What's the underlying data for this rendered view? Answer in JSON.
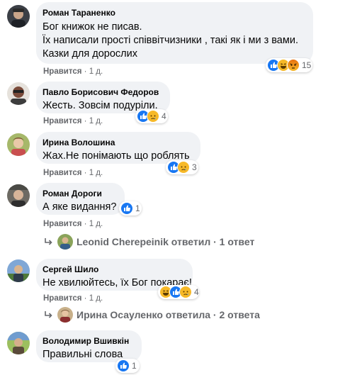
{
  "comments": [
    {
      "author": "Роман Тараненко",
      "lines": [
        "Бог книжок не писав.",
        "Їх написали прості співвітчизники , такі як і ми з вами.",
        "Казки для дорослих"
      ],
      "reactions": [
        "like",
        "haha",
        "angry"
      ],
      "reaction_count": "15",
      "like_label": "Нравится",
      "time": "1 д."
    },
    {
      "author": "Павло Борисович Федоров",
      "lines": [
        "Жесть. Зовсім подуріли."
      ],
      "reactions": [
        "like",
        "sad"
      ],
      "reaction_count": "4",
      "like_label": "Нравится",
      "time": "1 д."
    },
    {
      "author": "Ирина Волошина",
      "lines": [
        "Жах.Не понімають що роблять"
      ],
      "reactions": [
        "like",
        "sad"
      ],
      "reaction_count": "3",
      "like_label": "Нравится",
      "time": "1 д."
    },
    {
      "author": "Роман Дороги",
      "lines": [
        "А яке видання?"
      ],
      "reactions": [
        "like"
      ],
      "reaction_count": "1",
      "like_label": "Нравится",
      "time": "1 д.",
      "reply": "Leonid Cherepeinik ответил · 1 ответ"
    },
    {
      "author": "Сергей Шило",
      "lines": [
        "Не хвилюйтесь, їх Бог покарає!"
      ],
      "reactions": [
        "haha",
        "like",
        "sad"
      ],
      "reaction_count": "4",
      "like_label": "Нравится",
      "time": "1 д.",
      "reply": "Ирина Осауленко ответила · 2 ответа"
    },
    {
      "author": "Володимир Вшивкін",
      "lines": [
        "Правильні слова"
      ],
      "reactions": [
        "like"
      ],
      "reaction_count": "1"
    }
  ],
  "colors": {
    "bubble": "#f0f2f5",
    "meta_text": "#65676b",
    "like_blue": "#1877f2",
    "haha_yellow": "#f7b928",
    "angry_orange": "#e9710f"
  }
}
